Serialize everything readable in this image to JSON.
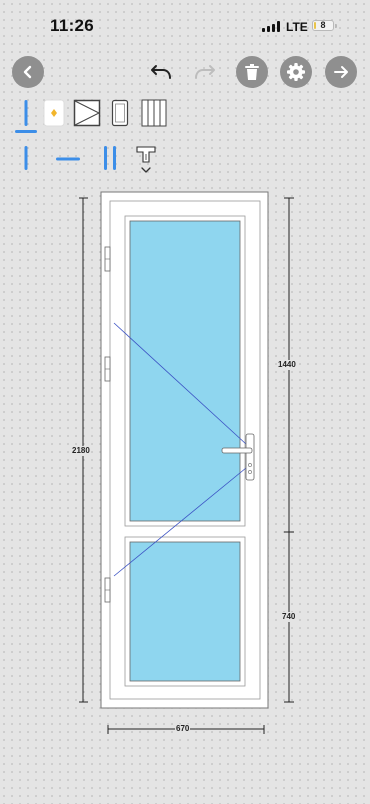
{
  "status_bar": {
    "time": "11:26",
    "network": "LTE",
    "battery_level": "8",
    "battery_fraction": 0.08,
    "signal_bars": 4
  },
  "toolbar": {
    "back_icon": "chevron-left-icon",
    "undo_icon": "undo-icon",
    "redo_icon": "redo-icon",
    "delete_icon": "trash-icon",
    "settings_icon": "gear-icon",
    "next_icon": "arrow-right-icon"
  },
  "tools": {
    "row1": [
      "vertical-profile-tool",
      "sash-light-tool",
      "tilt-sash-tool",
      "door-panel-tool",
      "vertical-mullions-tool"
    ],
    "row2": [
      "vertical-post-tool",
      "horizontal-post-tool",
      "double-post-tool",
      "t-profile-dropdown-tool"
    ]
  },
  "colors": {
    "accent": "#3c8ee8",
    "glass": "#8fd6ef",
    "frame": "#ffffff",
    "round_button": "#8f8f8f",
    "opening_line": "#3b52c4"
  },
  "dimensions": {
    "total_height": "2180",
    "width": "670",
    "top_panel_height": "1440",
    "bottom_panel_height": "740"
  }
}
